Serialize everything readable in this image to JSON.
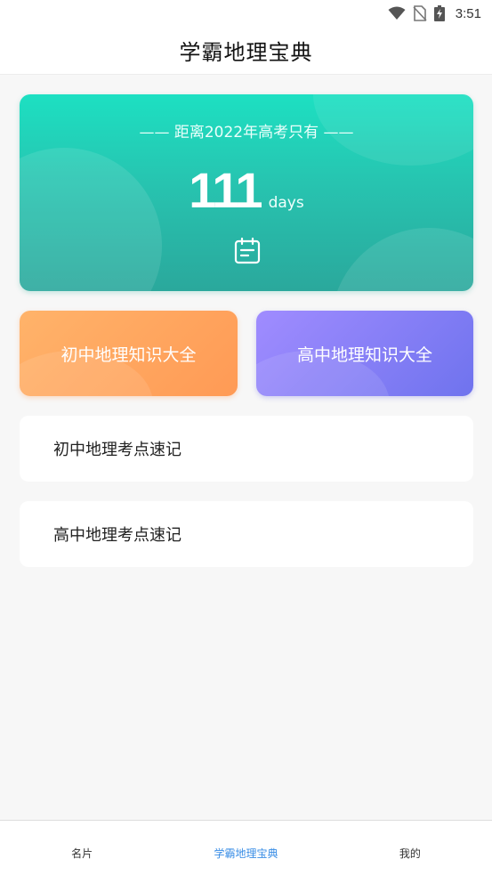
{
  "status_bar": {
    "time": "3:51",
    "icons": [
      "wifi-icon",
      "no-sim-icon",
      "battery-charging-icon"
    ]
  },
  "header": {
    "title": "学霸地理宝典"
  },
  "countdown": {
    "heading": "—— 距离2022年高考只有 ——",
    "days": "111",
    "unit": "days",
    "icon": "calendar-icon"
  },
  "knowledge_cards": [
    {
      "label": "初中地理知识大全",
      "color": "#ffa460"
    },
    {
      "label": "高中地理知识大全",
      "color": "#8580f5"
    }
  ],
  "list_items": [
    {
      "label": "初中地理考点速记"
    },
    {
      "label": "高中地理考点速记"
    }
  ],
  "bottom_nav": {
    "items": [
      {
        "label": "名片"
      },
      {
        "label": "学霸地理宝典",
        "active": true
      },
      {
        "label": "我的"
      }
    ],
    "active_color": "#3a8ee6"
  },
  "colors": {
    "countdown_gradient_top": "#1de0c2",
    "countdown_gradient_bottom": "#2aa89c",
    "background": "#f7f7f7"
  }
}
